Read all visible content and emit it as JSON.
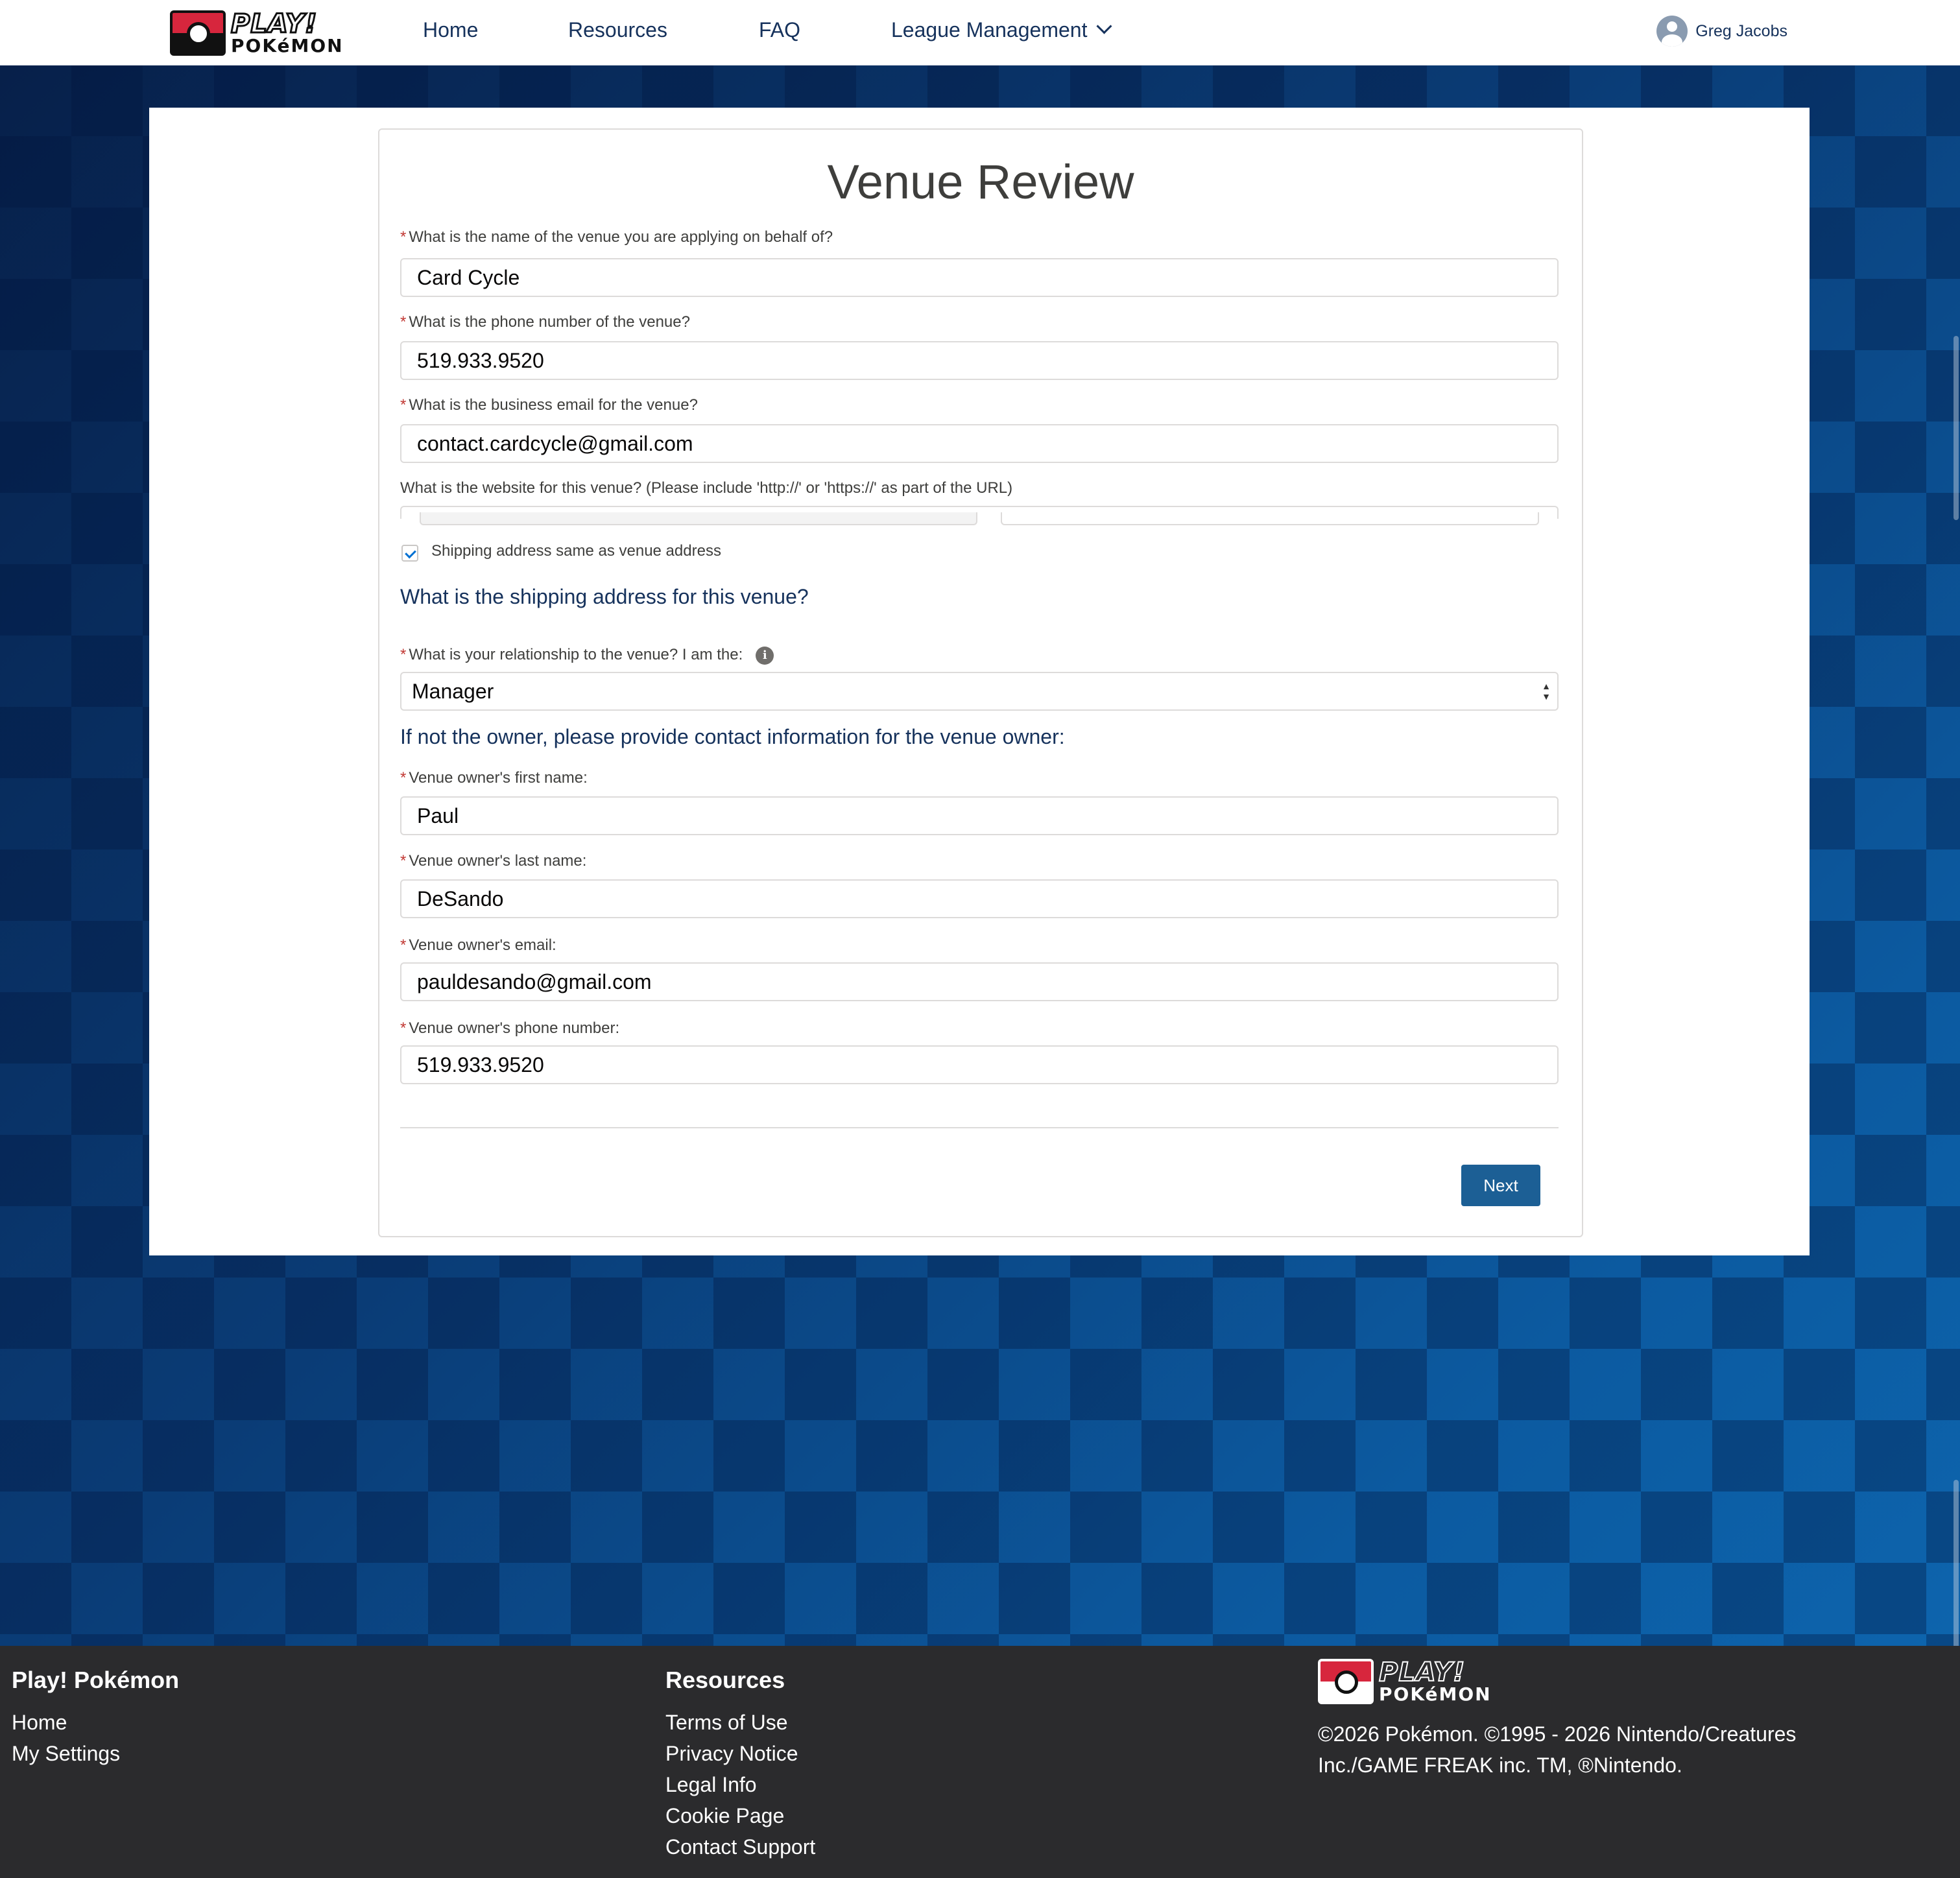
{
  "header": {
    "brand_line1": "PLAY!",
    "brand_line2": "POKéMON",
    "nav": [
      {
        "label": "Home"
      },
      {
        "label": "Resources"
      },
      {
        "label": "FAQ"
      },
      {
        "label": "League Management"
      }
    ],
    "user_name": "Greg Jacobs"
  },
  "form": {
    "title": "Venue Review",
    "venue_name": {
      "label": "What is the name of the venue you are applying on behalf of?",
      "value": "Card Cycle"
    },
    "venue_phone": {
      "label": "What is the phone number of the venue?",
      "value": "519.933.9520"
    },
    "venue_email": {
      "label": "What is the business email for the venue?",
      "value": "contact.cardcycle@gmail.com"
    },
    "website": {
      "label": "What is the website for this venue? (Please include 'http://' or 'https://' as part of the URL)"
    },
    "shipping_same": {
      "label": "Shipping address same as venue address",
      "checked": true
    },
    "shipping_heading": "What is the shipping address for this venue?",
    "relationship": {
      "label": "What is your relationship to the venue? I am the:",
      "value": "Manager",
      "info_icon": "info-icon"
    },
    "owner_heading": "If not the owner, please provide contact information for the venue owner:",
    "owner_first": {
      "label": "Venue owner's first name:",
      "value": "Paul"
    },
    "owner_last": {
      "label": "Venue owner's last name:",
      "value": "DeSando"
    },
    "owner_email": {
      "label": "Venue owner's email:",
      "value": "pauldesando@gmail.com"
    },
    "owner_phone": {
      "label": "Venue owner's phone number:",
      "value": "519.933.9520"
    },
    "next_label": "Next",
    "required_mark": "*"
  },
  "footer": {
    "col1": {
      "title": "Play! Pokémon",
      "links": [
        "Home",
        "My Settings"
      ]
    },
    "col2": {
      "title": "Resources",
      "links": [
        "Terms of Use",
        "Privacy Notice",
        "Legal Info",
        "Cookie Page",
        "Contact Support"
      ]
    },
    "copyright": "©2026 Pokémon. ©1995 - 2026 Nintendo/Creatures Inc./GAME FREAK inc. TM, ®Nintendo."
  },
  "colors": {
    "accent_button": "#1c5f95",
    "required": "#c23934",
    "footer_bg": "#2b2b2d"
  }
}
